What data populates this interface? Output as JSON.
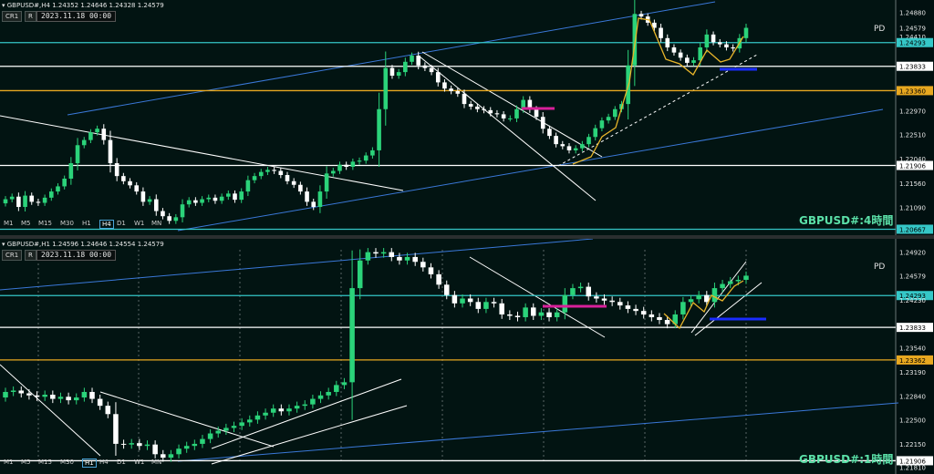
{
  "colors": {
    "bull": "#2bd37a",
    "bear": "#ffffff",
    "bg": "#021412",
    "zigzag": "#e8b52a",
    "channel": "#3a78d8",
    "cyan": "#35c7c7",
    "gold": "#e8a820",
    "magenta": "#d8209a",
    "blue": "#1a2cff"
  },
  "top": {
    "header": "GBPUSD#,H4  1.24352 1.24646 1.24328 1.24579",
    "cr": "CR1",
    "r": "R",
    "date": "2023.11.18 00:00",
    "pd": "PD",
    "watermark": "GBPUSD#:4時間",
    "timeframes": [
      "M1",
      "M5",
      "M15",
      "M30",
      "H1",
      "H4",
      "D1",
      "W1",
      "MN"
    ],
    "active_tf": "H4",
    "price_labels": [
      "1.24880",
      "1.24579",
      "1.24410",
      "1.24293",
      "1.23833",
      "1.23360",
      "1.22970",
      "1.22510",
      "1.22040",
      "1.21906",
      "1.21560",
      "1.21090",
      "1.20667"
    ]
  },
  "bottom": {
    "header": "GBPUSD#,H1  1.24596 1.24646 1.24554 1.24579",
    "cr": "CR1",
    "r": "R",
    "date": "2023.11.18 00:00",
    "pd": "PD",
    "watermark": "GBPUSD#:1時間",
    "timeframes": [
      "M1",
      "M5",
      "M15",
      "M30",
      "H1",
      "H4",
      "D1",
      "W1",
      "MN"
    ],
    "active_tf": "H1",
    "price_labels": [
      "1.24920",
      "1.24579",
      "1.24293",
      "1.24230",
      "1.23833",
      "1.23540",
      "1.23362",
      "1.23190",
      "1.22840",
      "1.22500",
      "1.22150",
      "1.21906",
      "1.21810"
    ]
  },
  "chart_data": [
    {
      "type": "candlestick",
      "symbol": "GBPUSD#",
      "timeframe": "H4",
      "ohlc_last": {
        "open": 1.24352,
        "high": 1.24646,
        "low": 1.24328,
        "close": 1.24579
      },
      "horizontal_levels": [
        {
          "price": 1.24293,
          "color": "cyan"
        },
        {
          "price": 1.23833,
          "color": "white"
        },
        {
          "price": 1.2336,
          "color": "gold"
        },
        {
          "price": 1.21906,
          "color": "white"
        },
        {
          "price": 1.20667,
          "color": "cyan"
        }
      ],
      "ylim": [
        1.2064,
        1.2505
      ],
      "closes": [
        1.2125,
        1.213,
        1.211,
        1.2132,
        1.212,
        1.2118,
        1.2128,
        1.214,
        1.215,
        1.2165,
        1.2195,
        1.223,
        1.224,
        1.2255,
        1.2262,
        1.224,
        1.2195,
        1.217,
        1.216,
        1.2152,
        1.214,
        1.212,
        1.2125,
        1.2102,
        1.2092,
        1.2083,
        1.209,
        1.2115,
        1.2123,
        1.2118,
        1.2125,
        1.2128,
        1.2122,
        1.213,
        1.2136,
        1.2124,
        1.214,
        1.2162,
        1.217,
        1.2178,
        1.2182,
        1.218,
        1.2172,
        1.216,
        1.2153,
        1.214,
        1.212,
        1.211,
        1.214,
        1.2175,
        1.218,
        1.2192,
        1.2188,
        1.2198,
        1.22,
        1.221,
        1.222,
        1.23,
        1.238,
        1.2365,
        1.2372,
        1.2392,
        1.2404,
        1.2385,
        1.238,
        1.2372,
        1.2352,
        1.234,
        1.2335,
        1.233,
        1.231,
        1.2305,
        1.23,
        1.2298,
        1.2292,
        1.229,
        1.2282,
        1.2282,
        1.23,
        1.2318,
        1.23,
        1.2285,
        1.2262,
        1.2248,
        1.2232,
        1.2228,
        1.222,
        1.2224,
        1.2232,
        1.2246,
        1.2263,
        1.2278,
        1.2285,
        1.23,
        1.231,
        1.2385,
        1.2485,
        1.248,
        1.2468,
        1.2458,
        1.2438,
        1.242,
        1.241,
        1.24,
        1.239,
        1.2395,
        1.242,
        1.2445,
        1.243,
        1.2426,
        1.242,
        1.2418,
        1.2438,
        1.2458
      ]
    },
    {
      "type": "candlestick",
      "symbol": "GBPUSD#",
      "timeframe": "H1",
      "ohlc_last": {
        "open": 1.24596,
        "high": 1.24646,
        "low": 1.24554,
        "close": 1.24579
      },
      "horizontal_levels": [
        {
          "price": 1.24293,
          "color": "cyan"
        },
        {
          "price": 1.23833,
          "color": "white"
        },
        {
          "price": 1.23362,
          "color": "gold"
        },
        {
          "price": 1.21906,
          "color": "white"
        }
      ],
      "ylim": [
        1.2178,
        1.2506
      ],
      "closes": [
        1.229,
        1.2292,
        1.2288,
        1.2285,
        1.2283,
        1.2286,
        1.228,
        1.2283,
        1.2278,
        1.2282,
        1.229,
        1.228,
        1.227,
        1.2258,
        1.2215,
        1.2214,
        1.2216,
        1.2212,
        1.2214,
        1.22,
        1.2195,
        1.22,
        1.2208,
        1.2212,
        1.2215,
        1.2222,
        1.223,
        1.2234,
        1.2238,
        1.2241,
        1.2246,
        1.225,
        1.2256,
        1.226,
        1.2266,
        1.2262,
        1.2266,
        1.227,
        1.2272,
        1.228,
        1.2285,
        1.229,
        1.23,
        1.2304,
        1.244,
        1.248,
        1.2492,
        1.249,
        1.2492,
        1.2485,
        1.248,
        1.2485,
        1.2478,
        1.247,
        1.246,
        1.2445,
        1.243,
        1.2418,
        1.2425,
        1.242,
        1.241,
        1.242,
        1.2418,
        1.2402,
        1.24,
        1.2398,
        1.2412,
        1.24,
        1.2405,
        1.2398,
        1.2405,
        1.243,
        1.244,
        1.2442,
        1.2428,
        1.2425,
        1.2422,
        1.242,
        1.2415,
        1.241,
        1.2407,
        1.2402,
        1.2398,
        1.2394,
        1.2388,
        1.2402,
        1.242,
        1.2424,
        1.243,
        1.242,
        1.244,
        1.2446,
        1.245,
        1.2452,
        1.2458
      ]
    }
  ]
}
